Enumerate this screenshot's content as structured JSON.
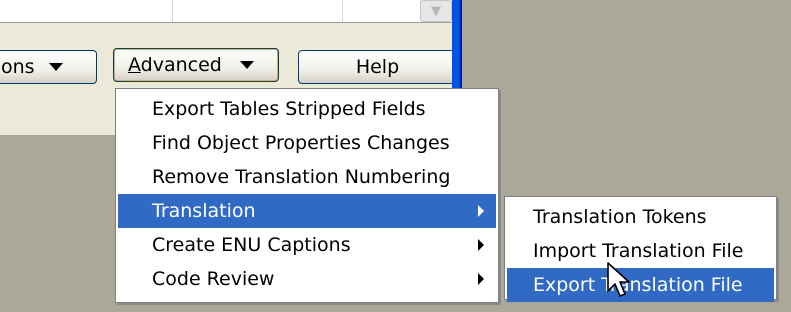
{
  "toolbar": {
    "options_label": "ons",
    "advanced_label_accel": "A",
    "advanced_label_rest": "dvanced",
    "help_label": "Help"
  },
  "advanced_menu": {
    "items": [
      {
        "label": "Export Tables Stripped Fields",
        "submenu": false
      },
      {
        "label": "Find Object Properties Changes",
        "submenu": false
      },
      {
        "label": "Remove Translation Numbering",
        "submenu": false
      },
      {
        "label": "Translation",
        "submenu": true,
        "highlighted": true
      },
      {
        "label": "Create ENU Captions",
        "submenu": true
      },
      {
        "label": "Code Review",
        "submenu": true
      }
    ]
  },
  "translation_submenu": {
    "items": [
      {
        "label": "Translation Tokens"
      },
      {
        "label": "Import Translation File"
      },
      {
        "label": "Export Translation File",
        "highlighted": true
      }
    ]
  },
  "colors": {
    "highlight": "#316ac5",
    "desktop": "#aca899",
    "window_face": "#ece9d8"
  },
  "icons": [
    "chevron-down-icon",
    "chevron-right-icon",
    "arrow-cursor-icon"
  ]
}
